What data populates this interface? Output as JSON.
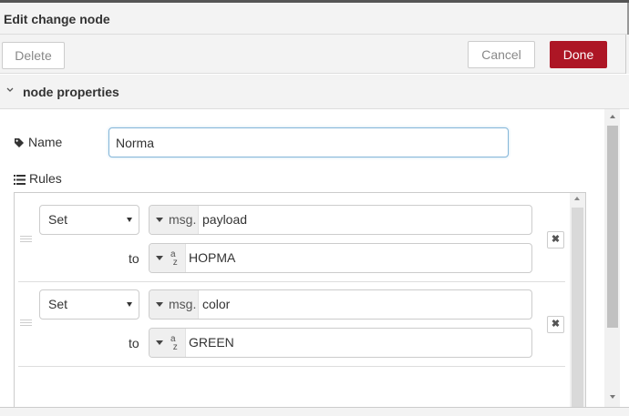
{
  "header": {
    "title": "Edit change node"
  },
  "toolbar": {
    "delete_label": "Delete",
    "cancel_label": "Cancel",
    "done_label": "Done"
  },
  "section": {
    "title": "node properties",
    "expanded": true
  },
  "form": {
    "name_label": "Name",
    "name_value": "Norma",
    "rules_label": "Rules"
  },
  "rules": [
    {
      "action": "Set",
      "target_prefix": "msg.",
      "target_value": "payload",
      "to_label": "to",
      "value_type_icon": "az-string-icon",
      "value": "HOPMA"
    },
    {
      "action": "Set",
      "target_prefix": "msg.",
      "target_value": "color",
      "to_label": "to",
      "value_type_icon": "az-string-icon",
      "value": "GREEN"
    }
  ],
  "colors": {
    "accent": "#ad1625",
    "focus_border": "#85b7d9"
  }
}
